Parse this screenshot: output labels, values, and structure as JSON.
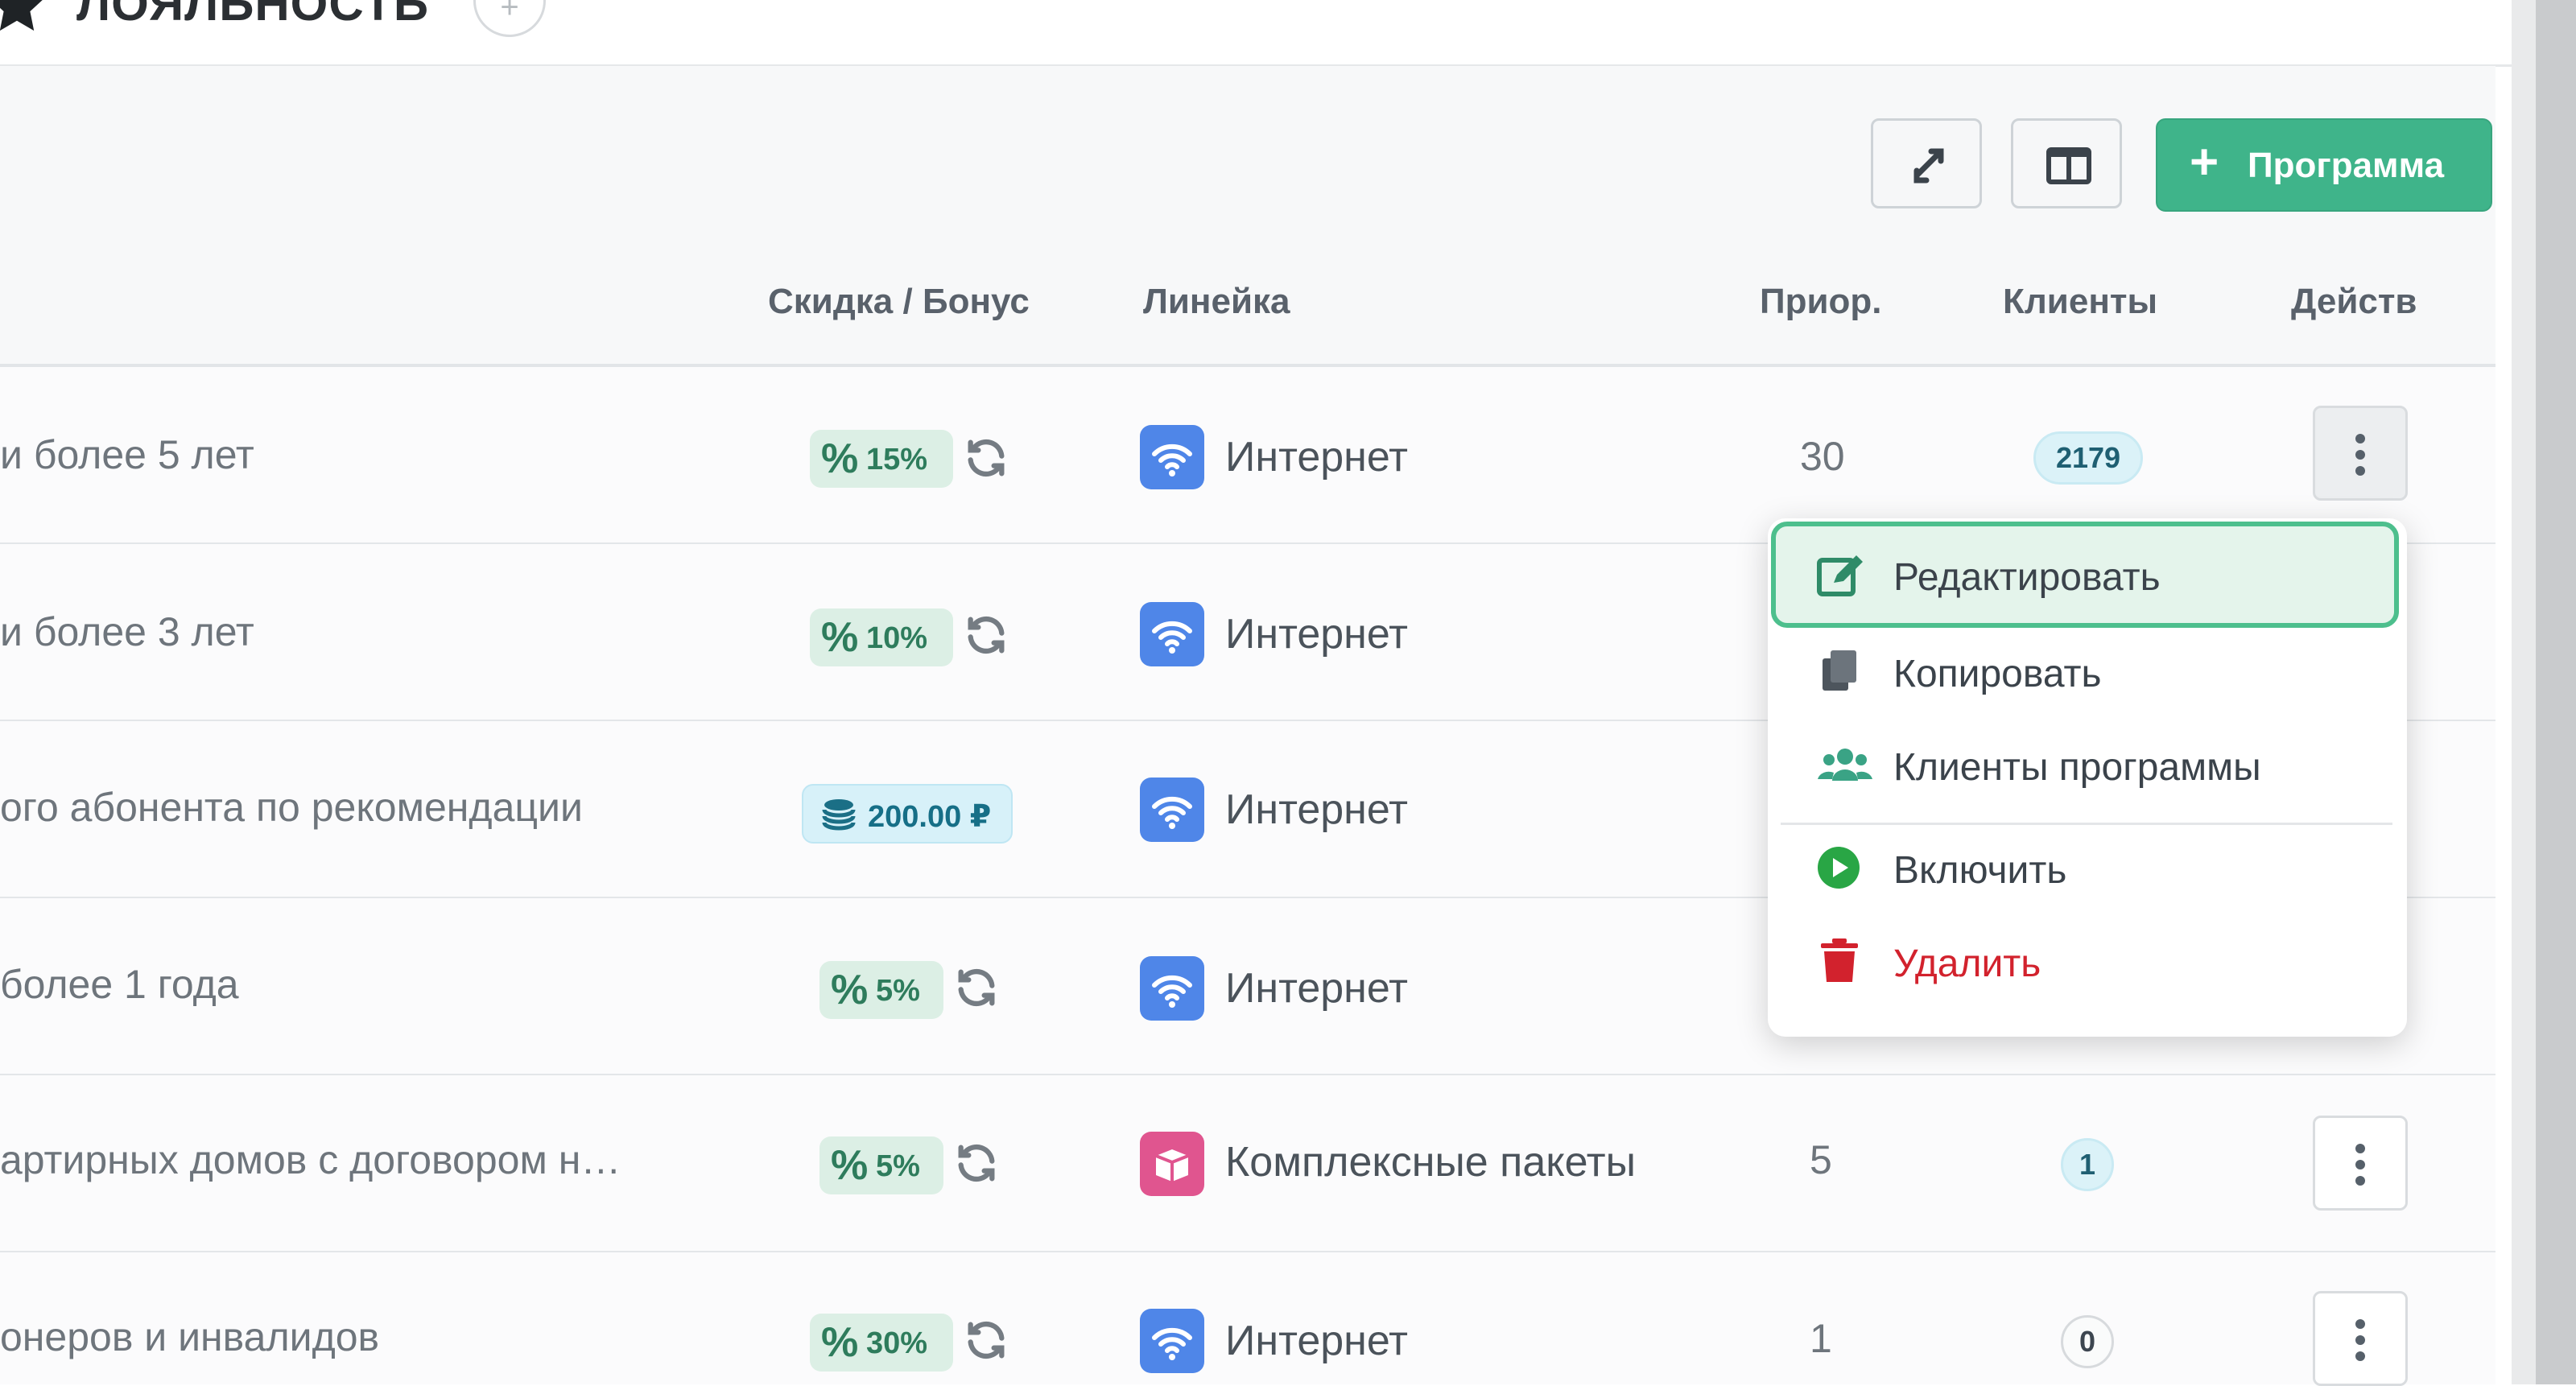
{
  "header": {
    "title": "ЛОЯЛЬНОСТЬ",
    "add_hint": "+"
  },
  "toolbar": {
    "add_program_label": "Программа",
    "plus": "+"
  },
  "table": {
    "columns": [
      "Скидка / Бонус",
      "Линейка",
      "Приор.",
      "Клиенты",
      "Действ"
    ],
    "rows": [
      {
        "name": "и более 5 лет",
        "discount": "15%",
        "line": "Интернет",
        "priority": "30",
        "clients": "2179"
      },
      {
        "name": "и более 3 лет",
        "discount": "10%",
        "line": "Интернет",
        "priority": "",
        "clients": ""
      },
      {
        "name": "ого абонента по рекомендации",
        "bonus": "200.00 ₽",
        "line": "Интернет",
        "priority": "",
        "clients": ""
      },
      {
        "name": "более 1 года",
        "discount": "5%",
        "line": "Интернет",
        "priority": "",
        "clients": ""
      },
      {
        "name": "артирных домов с договором н…",
        "discount": "5%",
        "line": "Комплексные пакеты",
        "priority": "5",
        "clients": "1"
      },
      {
        "name": "онеров и инвалидов",
        "discount": "30%",
        "line": "Интернет",
        "priority": "1",
        "clients": "0"
      }
    ]
  },
  "dropdown": {
    "items": [
      {
        "label": "Редактировать",
        "icon": "edit-icon"
      },
      {
        "label": "Копировать",
        "icon": "copy-icon"
      },
      {
        "label": "Клиенты программы",
        "icon": "users-icon"
      },
      {
        "label": "Включить",
        "icon": "play-icon"
      },
      {
        "label": "Удалить",
        "icon": "trash-icon"
      }
    ]
  },
  "colors": {
    "accent": "#3fb48a",
    "danger": "#d2222d",
    "line_internet": "#4f86e8",
    "line_complex": "#e0558f"
  }
}
